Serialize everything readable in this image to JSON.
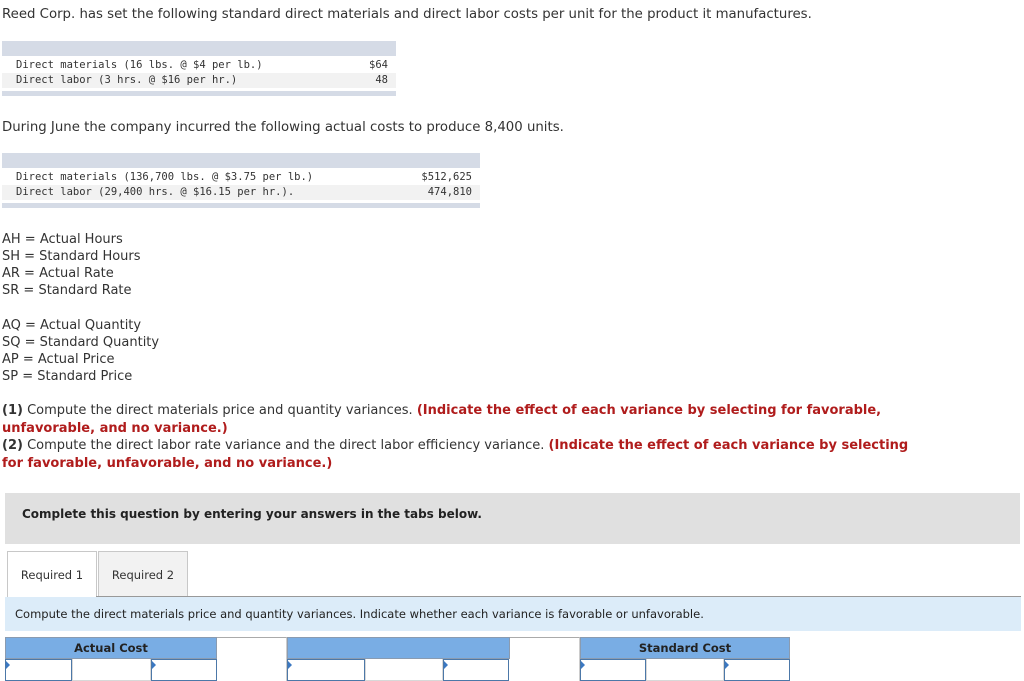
{
  "intro": {
    "standard_text": "Reed Corp. has set the following standard direct materials and direct labor costs per unit for the product it manufactures.",
    "actual_text": "During June the company incurred the following actual costs to produce 8,400 units."
  },
  "standard_costs": [
    {
      "label": "Direct materials (16 lbs. @ $4 per lb.)",
      "value": "$64"
    },
    {
      "label": "Direct labor (3 hrs. @ $16 per hr.)",
      "value": "48"
    }
  ],
  "actual_costs": [
    {
      "label": "Direct materials (136,700 lbs. @ $3.75 per lb.)",
      "value": "$512,625"
    },
    {
      "label": "Direct labor (29,400 hrs. @ $16.15 per hr.).",
      "value": "474,810"
    }
  ],
  "definitions_labor": [
    "AH = Actual Hours",
    "SH = Standard Hours",
    "AR = Actual Rate",
    "SR = Standard Rate"
  ],
  "definitions_materials": [
    "AQ = Actual Quantity",
    "SQ = Standard Quantity",
    "AP = Actual Price",
    "SP = Standard Price"
  ],
  "questions": [
    {
      "num": "(1)",
      "text": " Compute the direct materials price and quantity variances. ",
      "note": "(Indicate the effect of each variance by selecting for favorable, unfavorable, and no variance.)"
    },
    {
      "num": "(2)",
      "text": " Compute the direct labor rate variance and the direct labor efficiency variance. ",
      "note": "(Indicate the effect of each variance by selecting for favorable, unfavorable, and no variance.)"
    }
  ],
  "complete_box": "Complete this question by entering your answers in the tabs below.",
  "tabs": [
    {
      "label": "Required 1",
      "active": true
    },
    {
      "label": "Required 2",
      "active": false
    }
  ],
  "instruction": "Compute the direct materials price and quantity variances. Indicate whether each variance is favorable or unfavorable.",
  "variance_grid": {
    "headers": [
      "Actual Cost",
      "",
      "Standard Cost"
    ],
    "inputs": [
      "",
      "",
      "",
      "",
      "",
      ""
    ]
  },
  "colors": {
    "accent_red": "#b01c1c",
    "header_blue": "#79ade4",
    "instruction_bg": "#dcecf9",
    "table_bar": "#d5dbe6"
  }
}
